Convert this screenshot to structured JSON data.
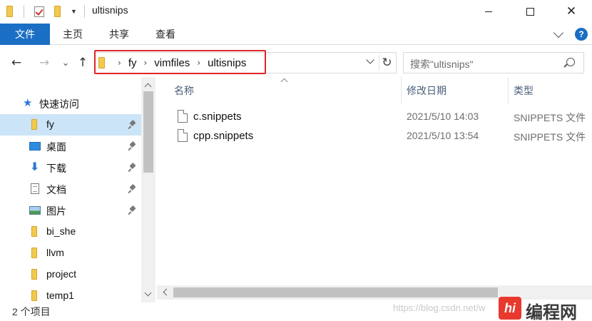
{
  "window": {
    "title": "ultisnips",
    "minimize_icon": "minimize-icon",
    "maximize_icon": "maximize-icon",
    "close_glyph": "✕"
  },
  "ribbon": {
    "tabs": [
      {
        "label": "文件",
        "active": true
      },
      {
        "label": "主页"
      },
      {
        "label": "共享"
      },
      {
        "label": "查看"
      }
    ],
    "help": "?"
  },
  "nav": {
    "back": "←",
    "forward": "→",
    "recent": "⌄",
    "up": "↑"
  },
  "address": {
    "crumbs": [
      "fy",
      "vimfiles",
      "ultisnips"
    ],
    "highlight_color": "#e0262b"
  },
  "search": {
    "placeholder": "搜索\"ultisnips\""
  },
  "sidebar": {
    "quick_access": "快速访问",
    "items": [
      {
        "label": "fy",
        "icon": "folder-icon",
        "pinned": true,
        "selected": true
      },
      {
        "label": "桌面",
        "icon": "desktop-icon",
        "pinned": true
      },
      {
        "label": "下载",
        "icon": "download-icon",
        "pinned": true
      },
      {
        "label": "文档",
        "icon": "document-icon",
        "pinned": true
      },
      {
        "label": "图片",
        "icon": "pictures-icon",
        "pinned": true
      },
      {
        "label": "bi_she",
        "icon": "folder-icon"
      },
      {
        "label": "llvm",
        "icon": "folder-icon"
      },
      {
        "label": "project",
        "icon": "folder-icon"
      },
      {
        "label": "temp1",
        "icon": "folder-icon"
      }
    ]
  },
  "columns": {
    "name": "名称",
    "modified": "修改日期",
    "type": "类型"
  },
  "files": [
    {
      "name": "c.snippets",
      "modified": "2021/5/10 14:03",
      "type": "SNIPPETS 文件"
    },
    {
      "name": "cpp.snippets",
      "modified": "2021/5/10 13:54",
      "type": "SNIPPETS 文件"
    }
  ],
  "status": {
    "count": "2 个项目"
  },
  "watermark": {
    "url": "https://blog.csdn.net/w",
    "logo_badge": "hi",
    "logo_text": "编程网"
  },
  "colors": {
    "accent": "#1a6fc4",
    "selection": "#cce4f7"
  }
}
